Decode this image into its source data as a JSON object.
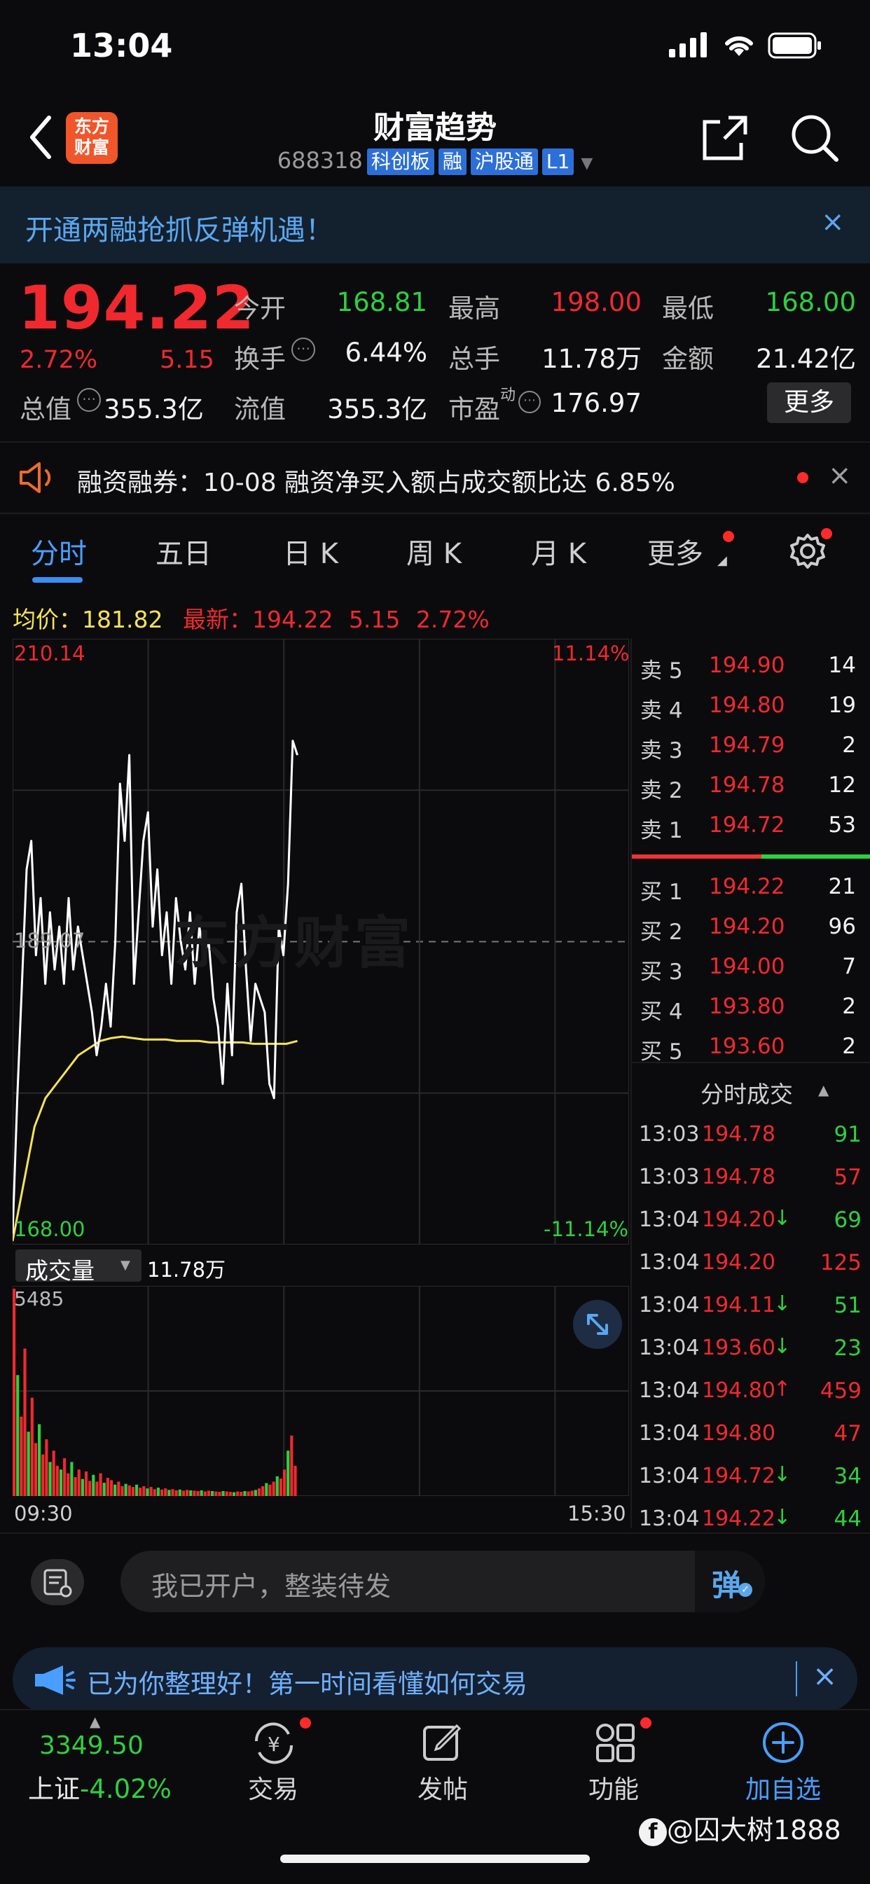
{
  "status_bar": {
    "time": "13:04"
  },
  "header": {
    "title": "财富趋势",
    "code": "688318",
    "tags": [
      "科创板",
      "融",
      "沪股通",
      "L1"
    ],
    "logo_text_line1": "东方",
    "logo_text_line2": "财富"
  },
  "banner": {
    "text": "开通两融抢抓反弹机遇！",
    "close": "×"
  },
  "quote": {
    "price": "194.22",
    "change_pct": "2.72%",
    "change": "5.15",
    "open_label": "今开",
    "open": "168.81",
    "high_label": "最高",
    "high": "198.00",
    "low_label": "最低",
    "low": "168.00",
    "turnover_label": "换手",
    "turnover": "6.44%",
    "volume_label": "总手",
    "volume": "11.78万",
    "amount_label": "金额",
    "amount": "21.42亿",
    "mktcap_label": "总值",
    "mktcap": "355.3亿",
    "float_label": "流值",
    "float_cap": "355.3亿",
    "pe_label": "市盈",
    "pe_sup": "动",
    "pe": "176.97",
    "more_label": "更多"
  },
  "notice": {
    "text": "融资融券：10-08 融资净买入额占成交额比达 6.85%",
    "close": "×"
  },
  "tabs": [
    "分时",
    "五日",
    "日 K",
    "周 K",
    "月 K",
    "更多"
  ],
  "avg_bar": {
    "avg_label": "均价：",
    "avg": "181.82",
    "latest_label": "最新：",
    "latest": "194.22",
    "latest_change": "5.15",
    "latest_pct": "2.72%"
  },
  "chart_labels": {
    "top_price": "210.14",
    "top_pct": "11.14%",
    "mid_price": "189.07",
    "bottom_price": "168.00",
    "bottom_pct": "-11.14%",
    "watermark": "东方财富",
    "volume_label": "成交量",
    "volume_value": "11.78万",
    "volume_max": "5485",
    "time_start": "09:30",
    "time_end": "15:30"
  },
  "chart_data": {
    "type": "line",
    "title": "",
    "ylim": [
      168.0,
      210.14
    ],
    "series": [
      {
        "values": [
          168.5,
          178,
          186,
          194,
          196,
          188,
          192,
          186,
          191,
          187,
          190,
          186,
          192,
          187,
          190,
          188,
          186,
          184,
          181,
          183,
          186,
          183,
          189,
          200,
          196,
          202,
          186,
          191,
          196,
          198,
          190,
          194,
          188,
          191,
          186,
          192,
          189,
          187,
          191,
          186,
          190,
          188,
          189,
          185,
          183,
          179,
          186,
          181,
          191,
          193,
          187,
          182,
          186,
          185,
          184,
          179,
          178,
          190,
          188,
          193,
          203,
          202
        ]
      },
      {
        "values": [
          168.0,
          172,
          176,
          178,
          179,
          180,
          181,
          181.5,
          182,
          182.2,
          182.3,
          182.2,
          182.1,
          182.1,
          182.1,
          182.0,
          182.0,
          182.0,
          181.9,
          181.9,
          181.9,
          181.9,
          181.8,
          181.8,
          181.8,
          181.8,
          182.0
        ]
      }
    ],
    "volume": {
      "ylim": [
        0,
        5485
      ],
      "values": [
        5485,
        3200,
        2100,
        3900,
        1700,
        2600,
        1400,
        1900,
        1100,
        1500,
        900,
        1200,
        800,
        700,
        1000,
        600,
        900,
        500,
        700,
        450,
        650,
        400,
        560,
        380,
        600,
        350,
        480,
        420,
        300,
        380,
        260,
        320,
        280,
        240,
        300,
        220,
        260,
        200,
        240,
        180,
        220,
        170,
        200,
        160,
        180,
        150,
        170,
        140,
        160,
        150,
        140,
        130,
        150,
        120,
        140,
        130,
        120,
        110,
        130,
        120,
        110,
        100,
        120,
        110,
        130,
        120,
        140,
        160,
        200,
        260,
        340,
        300,
        380,
        520,
        460,
        700,
        1200,
        1600,
        800
      ]
    }
  },
  "order_book": {
    "asks": [
      {
        "label": "卖 5",
        "price": "194.90",
        "vol": "14"
      },
      {
        "label": "卖 4",
        "price": "194.80",
        "vol": "19"
      },
      {
        "label": "卖 3",
        "price": "194.79",
        "vol": "2"
      },
      {
        "label": "卖 2",
        "price": "194.78",
        "vol": "12"
      },
      {
        "label": "卖 1",
        "price": "194.72",
        "vol": "53"
      }
    ],
    "bids": [
      {
        "label": "买 1",
        "price": "194.22",
        "vol": "21"
      },
      {
        "label": "买 2",
        "price": "194.20",
        "vol": "96"
      },
      {
        "label": "买 3",
        "price": "194.00",
        "vol": "7"
      },
      {
        "label": "买 4",
        "price": "193.80",
        "vol": "2"
      },
      {
        "label": "买 5",
        "price": "193.60",
        "vol": "2"
      }
    ]
  },
  "trades": {
    "header": "分时成交",
    "rows": [
      {
        "time": "13:03",
        "price": "194.78",
        "arrow": "",
        "vol": "91",
        "vol_color": "#2fcf3f"
      },
      {
        "time": "13:03",
        "price": "194.78",
        "arrow": "",
        "vol": "57",
        "vol_color": "#f0292e"
      },
      {
        "time": "13:04",
        "price": "194.20",
        "arrow": "↓",
        "vol": "69",
        "vol_color": "#2fcf3f"
      },
      {
        "time": "13:04",
        "price": "194.20",
        "arrow": "",
        "vol": "125",
        "vol_color": "#f0292e"
      },
      {
        "time": "13:04",
        "price": "194.11",
        "arrow": "↓",
        "vol": "51",
        "vol_color": "#2fcf3f"
      },
      {
        "time": "13:04",
        "price": "193.60",
        "arrow": "↓",
        "vol": "23",
        "vol_color": "#2fcf3f"
      },
      {
        "time": "13:04",
        "price": "194.80",
        "arrow": "↑",
        "vol": "459",
        "vol_color": "#f0292e"
      },
      {
        "time": "13:04",
        "price": "194.80",
        "arrow": "",
        "vol": "47",
        "vol_color": "#f0292e"
      },
      {
        "time": "13:04",
        "price": "194.72",
        "arrow": "↓",
        "vol": "34",
        "vol_color": "#2fcf3f"
      },
      {
        "time": "13:04",
        "price": "194.22",
        "arrow": "↓",
        "vol": "44",
        "vol_color": "#2fcf3f"
      }
    ]
  },
  "input_bar": {
    "placeholder": "我已开户，整装待发",
    "danmu_label": "弹"
  },
  "promo": {
    "text": "已为你整理好！第一时间看懂如何交易",
    "close": "×"
  },
  "bottom_nav": {
    "index_value": "3349.50",
    "index_name": "上证",
    "index_pct": "-4.02%",
    "items": [
      "交易",
      "发帖",
      "功能",
      "加自选"
    ]
  },
  "watermark_user": "@囚大树1888",
  "colors": {
    "up": "#f0292e",
    "down": "#2fcf3f",
    "accent": "#4a9eff",
    "price_line": "#ffffff",
    "avg_line": "#f4e25a"
  }
}
